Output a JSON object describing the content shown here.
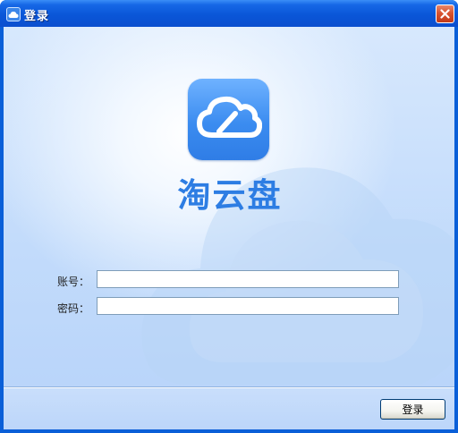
{
  "window": {
    "title": "登录",
    "title_icon": "cloud-icon",
    "close_icon": "close-icon"
  },
  "brand": {
    "logo_icon": "cloud-icon",
    "app_name": "淘云盘"
  },
  "form": {
    "account_label": "账号：",
    "account_value": "",
    "password_label": "密码：",
    "password_value": ""
  },
  "footer": {
    "login_label": "登录"
  },
  "colors": {
    "titlebar": "#0a56d8",
    "brand_blue": "#2d7de3",
    "background": "#c2dbfb",
    "close_button": "#d9532f"
  }
}
